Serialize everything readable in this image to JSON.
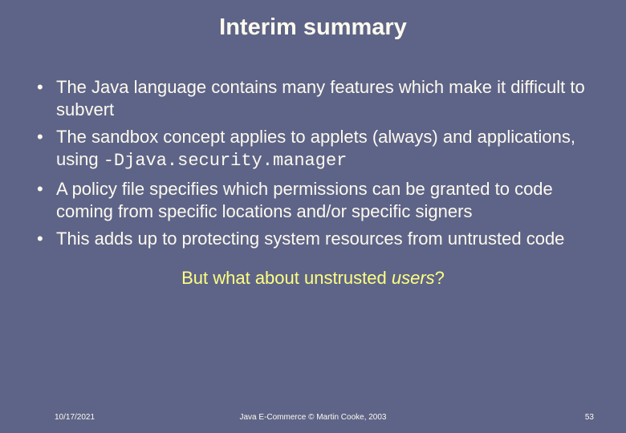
{
  "title": "Interim summary",
  "bullets": {
    "b1": "The Java language contains many features which make it difficult to subvert",
    "b2a": "The sandbox concept applies to applets (always) and applications, using ",
    "b2b": "-Djava.security.manager",
    "b3": "A policy file specifies which permissions can be granted to code coming from specific locations and/or specific signers",
    "b4": "This adds up to protecting system resources from untrusted code"
  },
  "callout": {
    "prefix": "But what about unstrusted ",
    "italic": "users",
    "suffix": "?"
  },
  "footer": {
    "date": "10/17/2021",
    "center": "Java E-Commerce © Martin Cooke, 2003",
    "page": "53"
  }
}
